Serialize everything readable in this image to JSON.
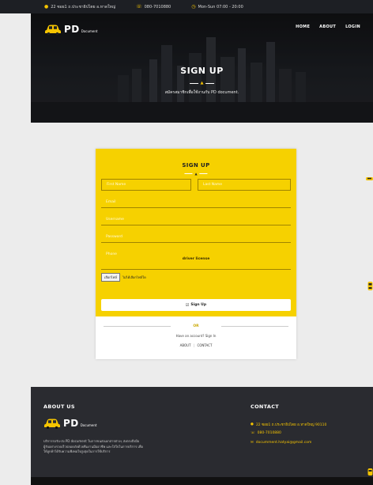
{
  "topbar": {
    "address": "22 ซอย1 ถ.ประชาธิปไตย อ.หาดใหญ่",
    "phone": "080-7010880",
    "hours": "Mon-Sun 07:00 - 20:00"
  },
  "brand": {
    "name": "PD",
    "tagline": "Document"
  },
  "nav": {
    "home": "HOME",
    "about": "ABOUT",
    "login": "LOGIN"
  },
  "hero": {
    "title": "SIGN UP",
    "subtitle": "สมัครสมาชิกเพื่อใช้งานกับ PD document."
  },
  "form": {
    "title": "SIGN UP",
    "first_name_placeholder": "First Name",
    "last_name_placeholder": "Last Name",
    "email_placeholder": "Email",
    "username_placeholder": "Username",
    "password_placeholder": "Password",
    "phone_placeholder": "Phone",
    "license_label": "driver license",
    "file_button": "เลือกไฟล์",
    "file_status": "ไม่ได้เลือกไฟล์ใด",
    "submit_label": "Sign Up",
    "or_label": "OR",
    "have_account": "Have an account? Sign In",
    "about_link": "ABOUT",
    "contact_link": "CONTACT",
    "link_separator": "|"
  },
  "footer": {
    "about_title": "ABOUT US",
    "about_text": "บริการรถรับ-ส่ง PD document ในการขนส่งเอกสารต่างๆ ส่งตรงถึงมือผู้รับอย่างรวดเร็วปลอดภัยด้วยทีมงานมืออาชีพ และใส่ใจในการบริการ เพื่อให้ลูกค้าได้รับความพึงพอใจสูงสุดในการใช้บริการ",
    "contact_title": "CONTACT",
    "contact_address": "22 ซอย1 ถ.ประชาธิปไตย อ.หาดใหญ่ 90110",
    "contact_phone": "080-7010880",
    "contact_email": "documment.hatyai@gmail.com"
  },
  "colors": {
    "accent": "#f6d100",
    "dark": "#2a2b30",
    "topbar": "#1d1f24"
  }
}
